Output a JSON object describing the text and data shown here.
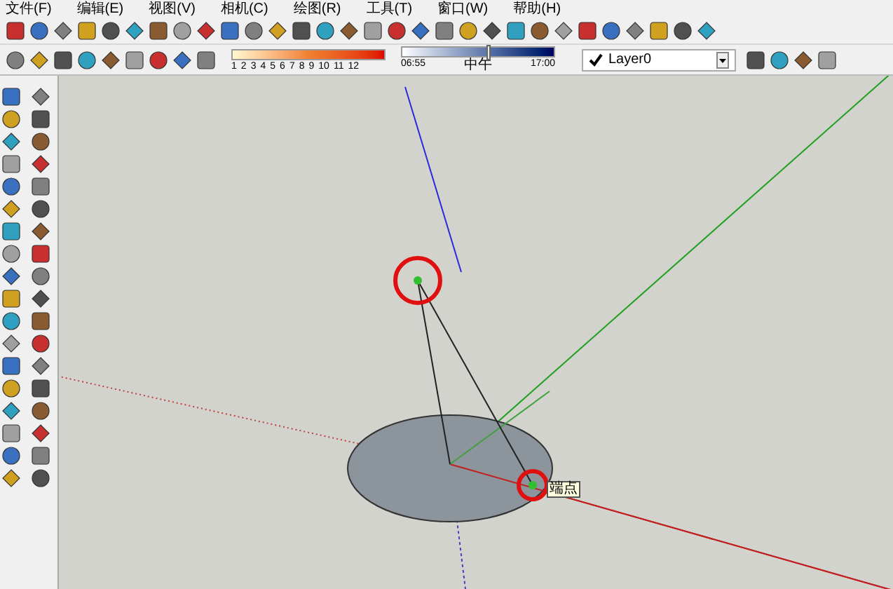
{
  "menu": [
    "文件(F)",
    "编辑(E)",
    "视图(V)",
    "相机(C)",
    "绘图(R)",
    "工具(T)",
    "窗口(W)",
    "帮助(H)"
  ],
  "shadow_scale": {
    "labels": [
      "1",
      "2",
      "3",
      "4",
      "5",
      "6",
      "7",
      "8",
      "9",
      "10",
      "11",
      "12"
    ]
  },
  "time_slider": {
    "start": "06:55",
    "middle": "中午",
    "end": "17:00",
    "level": 0.57
  },
  "layer": {
    "checked": true,
    "name": "Layer0"
  },
  "tooltip": "端点"
}
